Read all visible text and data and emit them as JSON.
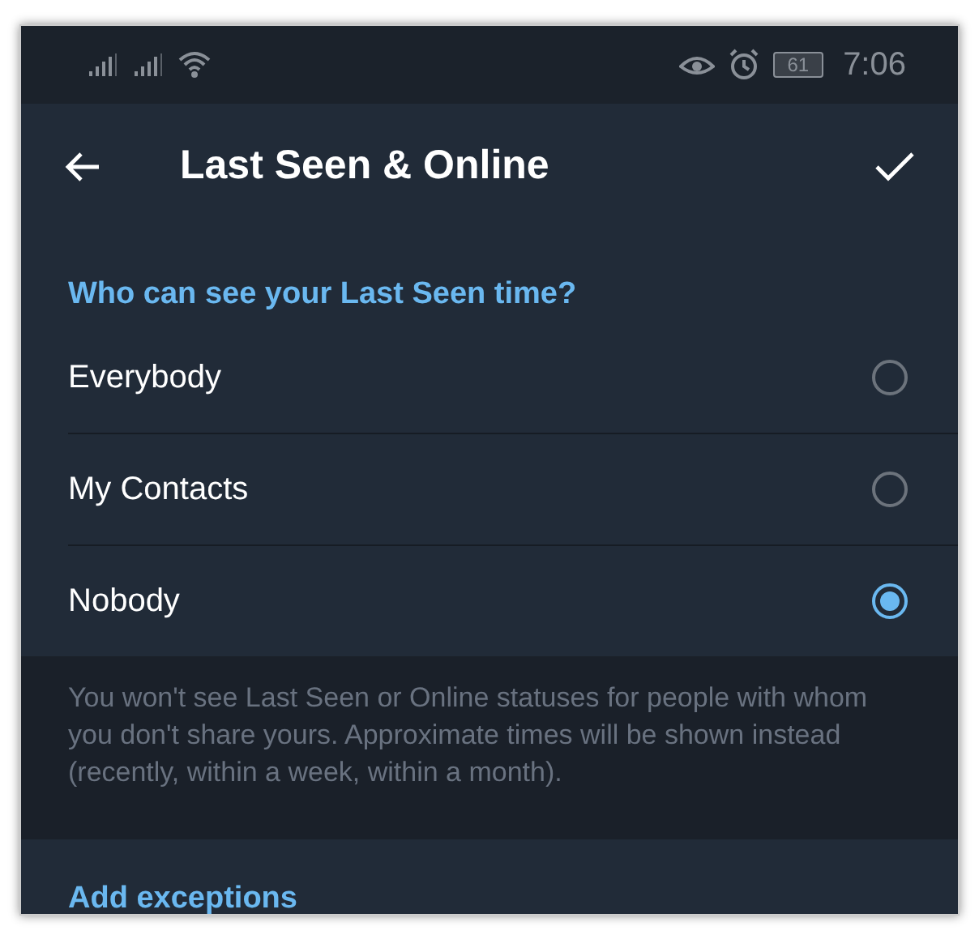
{
  "status_bar": {
    "battery": "61",
    "time": "7:06"
  },
  "toolbar": {
    "title": "Last Seen & Online"
  },
  "section": {
    "heading": "Who can see your Last Seen time?",
    "options": [
      {
        "label": "Everybody",
        "selected": false
      },
      {
        "label": "My Contacts",
        "selected": false
      },
      {
        "label": "Nobody",
        "selected": true
      }
    ]
  },
  "info": "You won't see Last Seen or Online statuses for people with whom you don't share yours. Approximate times will be shown instead (recently, within a week, within a month).",
  "exceptions": {
    "heading": "Add exceptions"
  }
}
